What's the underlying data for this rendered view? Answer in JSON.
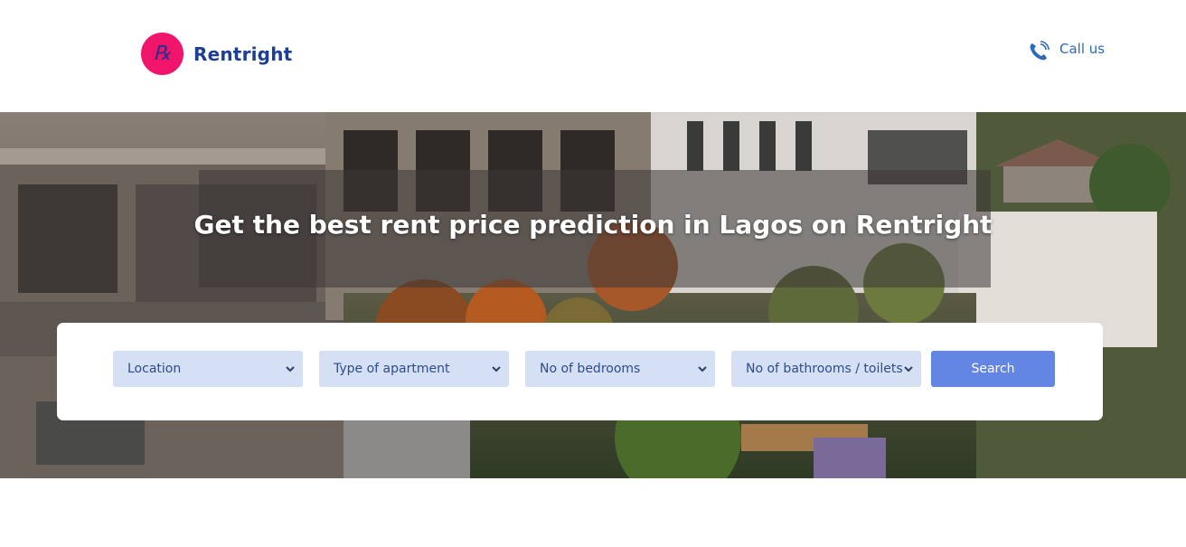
{
  "brand": {
    "name": "Rentright",
    "logo_glyph": "℞",
    "badge_color": "#f0156a",
    "text_color": "#1c3f93"
  },
  "header": {
    "call_label": "Call us",
    "call_icon": "phone-icon"
  },
  "hero": {
    "title": "Get the best rent price prediction in Lagos on Rentright"
  },
  "search": {
    "selects": [
      {
        "label": "Location"
      },
      {
        "label": "Type of apartment"
      },
      {
        "label": "No of bedrooms"
      },
      {
        "label": "No of bathrooms / toilets"
      }
    ],
    "button_label": "Search",
    "accent": "#6486e3",
    "select_bg": "#d6e0f5"
  }
}
